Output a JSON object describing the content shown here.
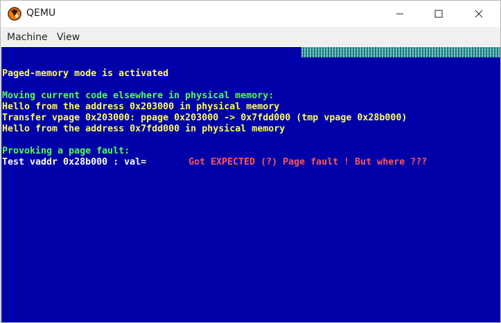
{
  "window": {
    "title": "QEMU",
    "app_icon": "qemu-logo-icon",
    "controls": {
      "minimize": "minimize-icon",
      "maximize": "maximize-icon",
      "close": "close-icon"
    }
  },
  "menubar": {
    "items": [
      {
        "label": "Machine"
      },
      {
        "label": "View"
      }
    ]
  },
  "screen": {
    "background_color": "#0000a8",
    "status_strip_color": "#0e8f88",
    "lines": [
      {
        "text": "Paged-memory mode is activated",
        "color": "#ffff55"
      },
      {
        "text": "Moving current code elsewhere in physical memory:",
        "color": "#55ff55"
      },
      {
        "text": "Hello from the address 0x203000 in physical memory",
        "color": "#ffff55"
      },
      {
        "text": "Transfer vpage 0x203000: ppage 0x203000 -> 0x7fdd000 (tmp vpage 0x28b000)",
        "color": "#ffff55"
      },
      {
        "text": "Hello from the address 0x7fdd000 in physical memory",
        "color": "#ffff55"
      },
      {
        "text": "Provoking a page fault:",
        "color": "#55ff55"
      },
      {
        "text": "Test vaddr 0x28b000 : val=",
        "color": "#ffffff"
      },
      {
        "text": "Got EXPECTED (?) Page fault ! But where ???",
        "color": "#ff5555"
      }
    ]
  }
}
